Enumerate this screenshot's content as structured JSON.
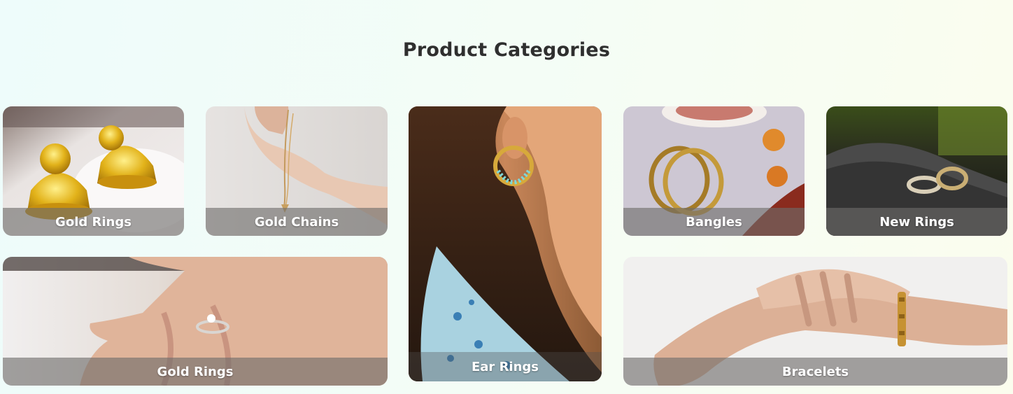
{
  "section": {
    "title": "Product Categories"
  },
  "categories": [
    {
      "label": "Gold Rings",
      "image": "gold-jhumka-earrings-photo"
    },
    {
      "label": "Gold Chains",
      "image": "hand-holding-gold-chain-photo"
    },
    {
      "label": "Ear Rings",
      "image": "woman-wearing-hoop-earring-photo"
    },
    {
      "label": "Bangles",
      "image": "gold-bangles-with-flowers-photo"
    },
    {
      "label": "New Rings",
      "image": "wedding-rings-on-stone-photo"
    },
    {
      "label": "Gold Rings",
      "image": "hand-with-diamond-ring-photo"
    },
    {
      "label": "Bracelets",
      "image": "wrist-with-gold-bracelet-photo"
    }
  ],
  "colors": {
    "title": "#2f2f2f",
    "label": "#ffffff",
    "label_band": "rgba(110,108,106,0.62)"
  }
}
